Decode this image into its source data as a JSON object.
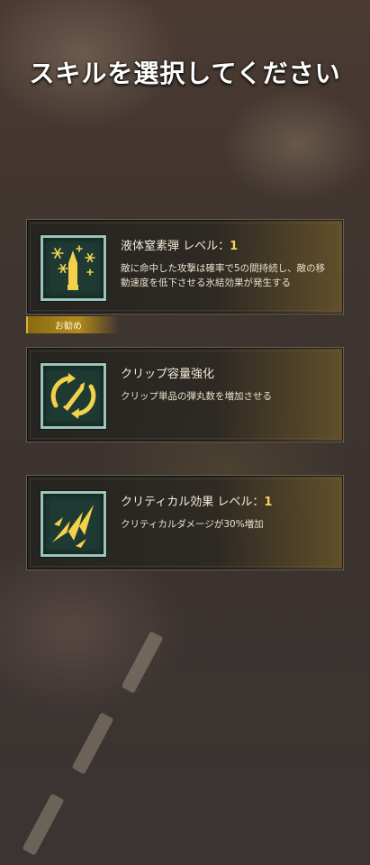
{
  "screen_title": "スキルを選択してください",
  "recommend_label": "お勧め",
  "skills": [
    {
      "name": "液体窒素弾 レベル：",
      "level": "1",
      "description": "敵に命中した攻撃は確率で5の間持続し、敵の移動速度を低下させる氷結効果が発生する",
      "icon": "frost-bullet-icon"
    },
    {
      "name": "クリップ容量強化",
      "level": "",
      "description": "クリップ単品の弾丸数を増加させる",
      "icon": "clip-capacity-icon"
    },
    {
      "name": "クリティカル効果 レベル：",
      "level": "1",
      "description": "クリティカルダメージが30%増加",
      "icon": "critical-strike-icon"
    }
  ],
  "colors": {
    "accent_gold": "#f4d35e",
    "icon_frame": "#9cc3b6",
    "icon_bg": "#1e3a33",
    "icon_fill": "#f2d24a"
  }
}
